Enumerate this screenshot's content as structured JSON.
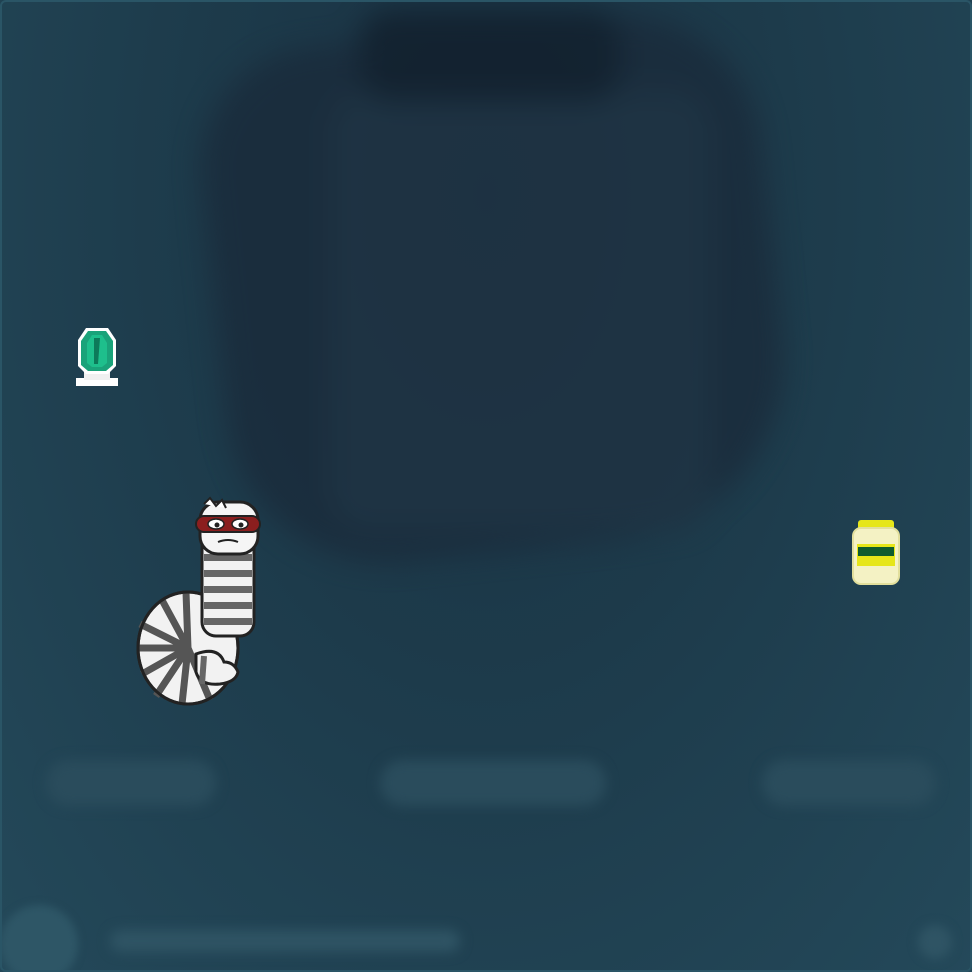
{
  "scene": {
    "sprites": {
      "player": "striped-masked-worm-icon",
      "gem": "green-emerald-trophy-icon",
      "jar": "mayonnaise-jar-icon"
    },
    "colors": {
      "background": "#1d3b4b",
      "gem": "#1aa37a",
      "jar_body": "#f4f2c4",
      "jar_lid": "#e6e619",
      "jar_label": "#0f5c2e",
      "worm_mask": "#8b1e1e"
    }
  }
}
